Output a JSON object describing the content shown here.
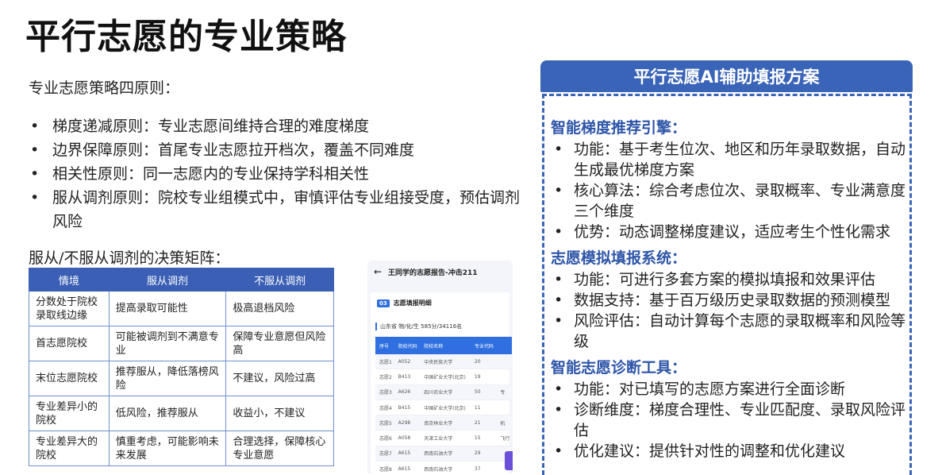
{
  "title": "平行志愿的专业策略",
  "intro": "专业志愿策略四原则：",
  "principles": [
    "梯度递减原则：专业志愿间维持合理的难度梯度",
    "边界保障原则：首尾专业志愿拉开档次，覆盖不同难度",
    "相关性原则：同一志愿内的专业保持学科相关性",
    "服从调剂原则：院校专业组模式中，审慎评估专业组接受度，预估调剂风险"
  ],
  "matrix": {
    "title": "服从/不服从调剂的决策矩阵：",
    "headers": [
      "情境",
      "服从调剂",
      "不服从调剂"
    ],
    "rows": [
      [
        "分数处于院校录取线边缘",
        "提高录取可能性",
        "极高退档风险"
      ],
      [
        "首志愿院校",
        "可能被调剂到不满意专业",
        "保障专业意愿但风险高"
      ],
      [
        "末位志愿院校",
        "推荐服从，降低落榜风险",
        "不建议，风险过高"
      ],
      [
        "专业差异小的院校",
        "低风险，推荐服从",
        "收益小，不建议"
      ],
      [
        "专业差异大的院校",
        "慎重考虑，可能影响未来发展",
        "合理选择，保障核心专业意愿"
      ]
    ]
  },
  "phone": {
    "back_icon": "arrow-left-icon",
    "header": "王同学的志愿报告-冲击211",
    "section_num": "03",
    "section_title": "志愿填报明细",
    "info": "山东省  物/化/生  585分/34116名",
    "columns": [
      "序号",
      "院校代码",
      "院校名称",
      "专业代码",
      ""
    ],
    "rows": [
      [
        "志愿1",
        "A052",
        "中央民族大学",
        "20",
        ""
      ],
      [
        "志愿2",
        "B413",
        "中国矿业大学(北京)",
        "19",
        ""
      ],
      [
        "志愿3",
        "A626",
        "四川农业大学",
        "50",
        "专"
      ],
      [
        "志愿4",
        "B415",
        "中国矿业大学(北京)",
        "11",
        ""
      ],
      [
        "志愿5",
        "A298",
        "南京林业大学",
        "21",
        "机"
      ],
      [
        "志愿6",
        "A058",
        "天津工业大学",
        "15",
        "飞行"
      ],
      [
        "志愿7",
        "A615",
        "西南石油大学",
        "29",
        ""
      ],
      [
        "志愿8",
        "A615",
        "西南石油大学",
        "37",
        ""
      ]
    ]
  },
  "panel": {
    "header": "平行志愿AI辅助填报方案",
    "sections": [
      {
        "title": "智能梯度推荐引擎：",
        "items": [
          "功能：基于考生位次、地区和历年录取数据，自动生成最优梯度方案",
          "核心算法：综合考虑位次、录取概率、专业满意度三个维度",
          "优势：动态调整梯度建议，适应考生个性化需求"
        ]
      },
      {
        "title": "志愿模拟填报系统：",
        "items": [
          "功能：可进行多套方案的模拟填报和效果评估",
          "数据支持：基于百万级历史录取数据的预测模型",
          "风险评估：自动计算每个志愿的录取概率和风险等级"
        ]
      },
      {
        "title": "智能志愿诊断工具：",
        "items": [
          "功能：对已填写的志愿方案进行全面诊断",
          "诊断维度：梯度合理性、专业匹配度、录取风险评估",
          "优化建议：提供针对性的调整和优化建议"
        ]
      }
    ]
  }
}
